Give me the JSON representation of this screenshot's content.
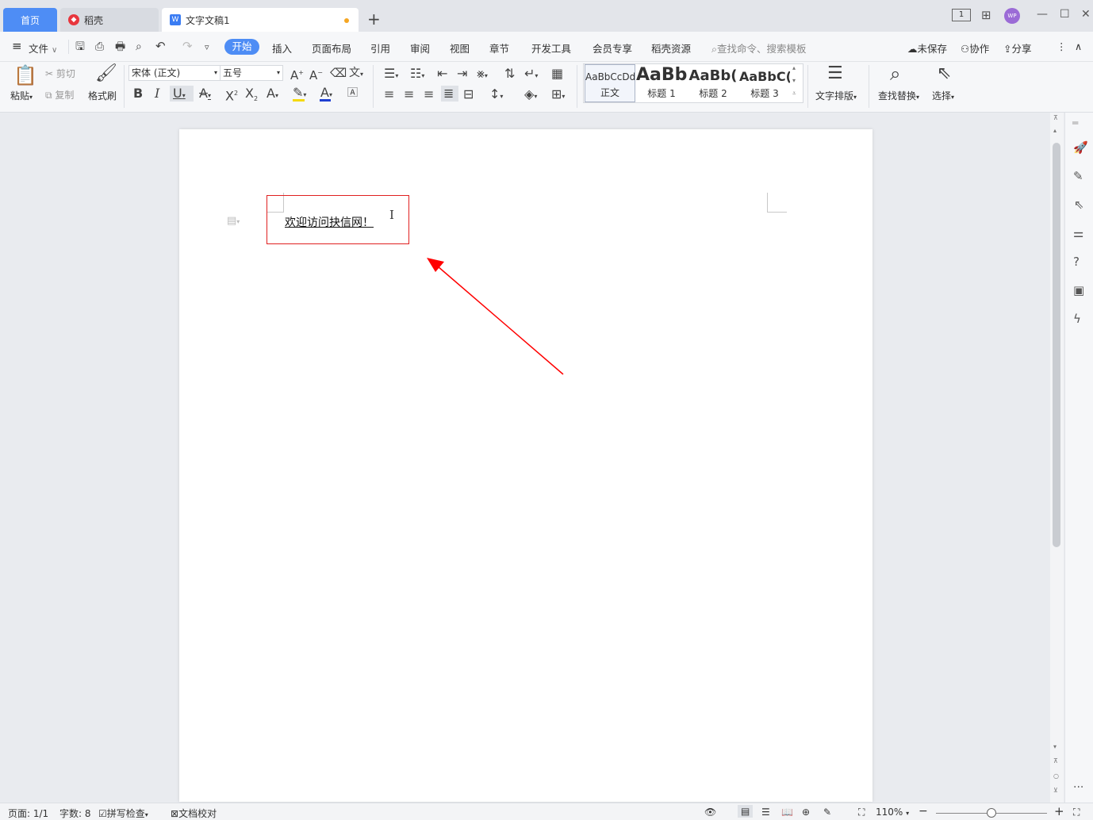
{
  "tabs": {
    "home": "首页",
    "daoke": "稻壳",
    "doc": "文字文稿1"
  },
  "titlebar": {
    "page_indicator": "1",
    "avatar": "WP"
  },
  "menu": {
    "file": "文件",
    "items": [
      "开始",
      "插入",
      "页面布局",
      "引用",
      "审阅",
      "视图",
      "章节",
      "开发工具",
      "会员专享",
      "稻壳资源"
    ],
    "search_placeholder": "查找命令、搜索模板",
    "unsaved": "未保存",
    "collab": "协作",
    "share": "分享"
  },
  "ribbon": {
    "paste": "粘贴",
    "cut": "剪切",
    "copy": "复制",
    "format_painter": "格式刷",
    "font_name": "宋体 (正文)",
    "font_size": "五号",
    "styles": [
      {
        "preview": "AaBbCcDd",
        "name": "正文"
      },
      {
        "preview": "AaBb",
        "name": "标题 1"
      },
      {
        "preview": "AaBb(",
        "name": "标题 2"
      },
      {
        "preview": "AaBbC(",
        "name": "标题 3"
      }
    ],
    "text_layout": "文字排版",
    "find_replace": "查找替换",
    "select": "选择"
  },
  "document": {
    "text": "欢迎访问抉信网！"
  },
  "status": {
    "page": "页面: 1/1",
    "words": "字数: 8",
    "spell": "拼写检查",
    "proof": "文档校对",
    "zoom": "110%"
  },
  "colors": {
    "accent": "#4e8df5",
    "highlight_box": "#e02020",
    "arrow": "#ff0000",
    "font_color_bar": "#1f3fd1",
    "highlight_bar": "#f5d90a"
  }
}
